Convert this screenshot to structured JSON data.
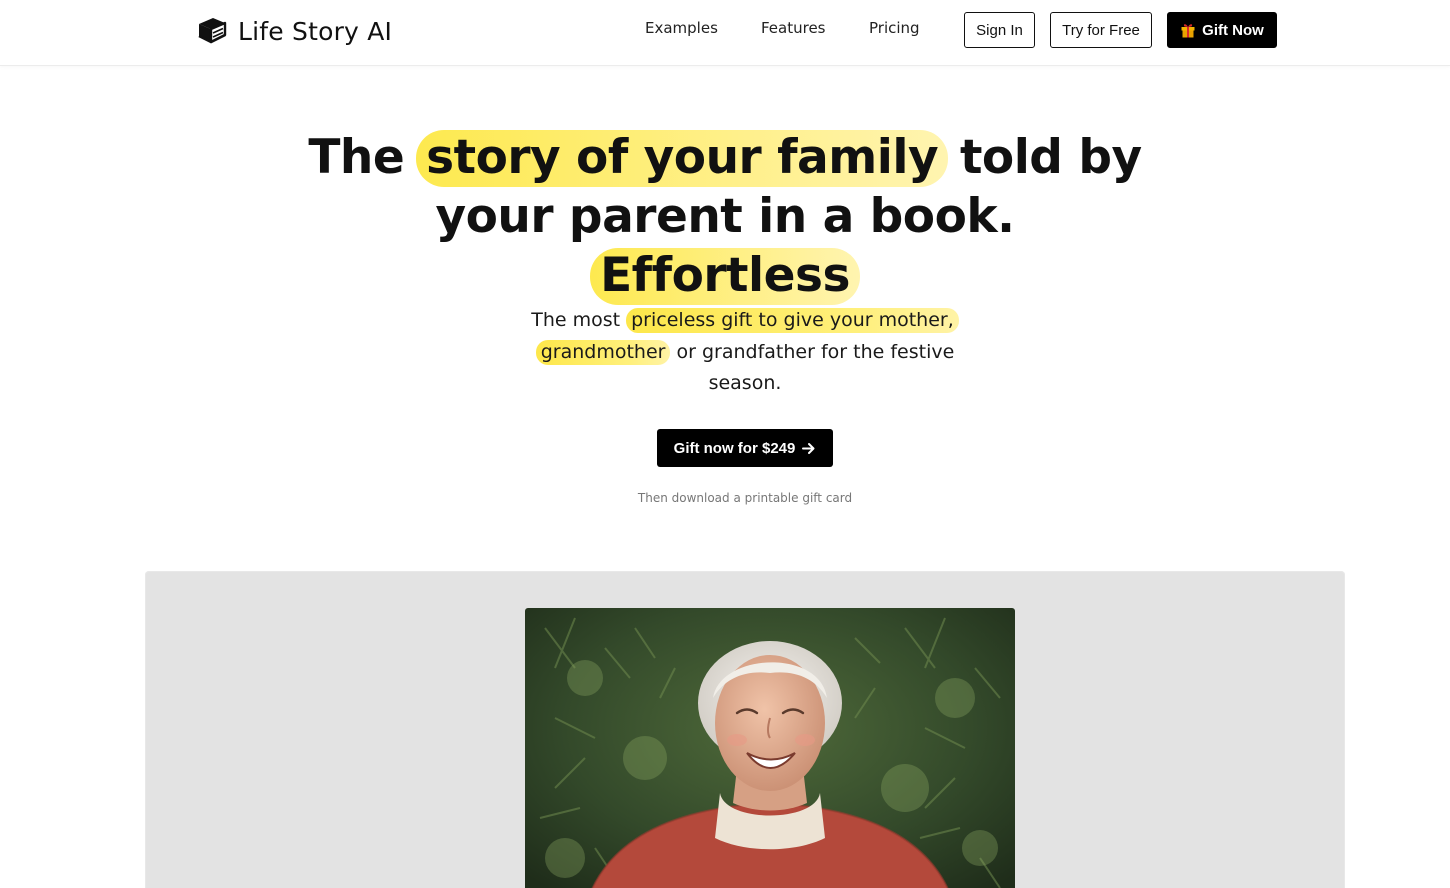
{
  "brand": {
    "name": "Life Story AI",
    "icon": "book-icon"
  },
  "nav": {
    "links": [
      "Examples",
      "Features",
      "Pricing"
    ],
    "sign_in": "Sign In",
    "try_free": "Try for Free",
    "gift_now": "Gift Now",
    "gift_icon": "gift-icon"
  },
  "hero": {
    "title_1": "The ",
    "title_hl_1": "story of your family",
    "title_2": " told by your parent in a book.",
    "title_hl_2": "Effortless",
    "sub_1": "The most ",
    "sub_hl_1": "priceless gift to give your mother,",
    "sub_hl_2": "grandmother",
    "sub_2": " or grandfather for the festive season.",
    "cta_label": "Gift now for $249",
    "cta_icon": "arrow-right-icon",
    "cta_note": "Then download a printable gift card"
  },
  "showcase": {
    "image": "smiling-grandmother-photo"
  },
  "colors": {
    "accent": "#000000",
    "highlight": "#fde94f",
    "panel": "#e3e3e3"
  }
}
